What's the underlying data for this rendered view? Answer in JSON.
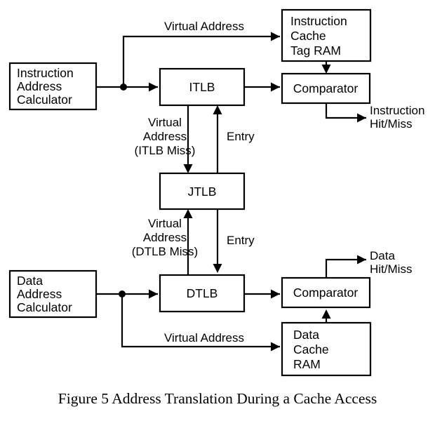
{
  "figure": {
    "caption": "Figure 5   Address Translation During a Cache Access",
    "background_color": "#ffffff",
    "line_color": "#000000"
  },
  "blocks": {
    "instruction_address_calculator": {
      "line1": "Instruction",
      "line2": "Address",
      "line3": "Calculator"
    },
    "itlb": {
      "label": "ITLB"
    },
    "instruction_cache_tag_ram": {
      "line1": "Instruction",
      "line2": "Cache",
      "line3": "Tag RAM"
    },
    "instruction_comparator": {
      "label": "Comparator"
    },
    "jtlb": {
      "label": "JTLB"
    },
    "data_address_calculator": {
      "line1": "Data",
      "line2": "Address",
      "line3": "Calculator"
    },
    "dtlb": {
      "label": "DTLB"
    },
    "data_comparator": {
      "label": "Comparator"
    },
    "data_cache_ram": {
      "line1": "Data",
      "line2": "Cache",
      "line3": "RAM"
    }
  },
  "edge_labels": {
    "top_virtual_address": "Virtual Address",
    "itlb_miss_l1": "Virtual",
    "itlb_miss_l2": "Address",
    "itlb_miss_l3": "(ITLB Miss)",
    "entry_upper": "Entry",
    "dtlb_miss_l1": "Virtual",
    "dtlb_miss_l2": "Address",
    "dtlb_miss_l3": "(DTLB Miss)",
    "entry_lower": "Entry",
    "bottom_virtual_address": "Virtual Address",
    "instruction_hit_miss_l1": "Instruction",
    "instruction_hit_miss_l2": "Hit/Miss",
    "data_hit_miss_l1": "Data",
    "data_hit_miss_l2": "Hit/Miss"
  }
}
